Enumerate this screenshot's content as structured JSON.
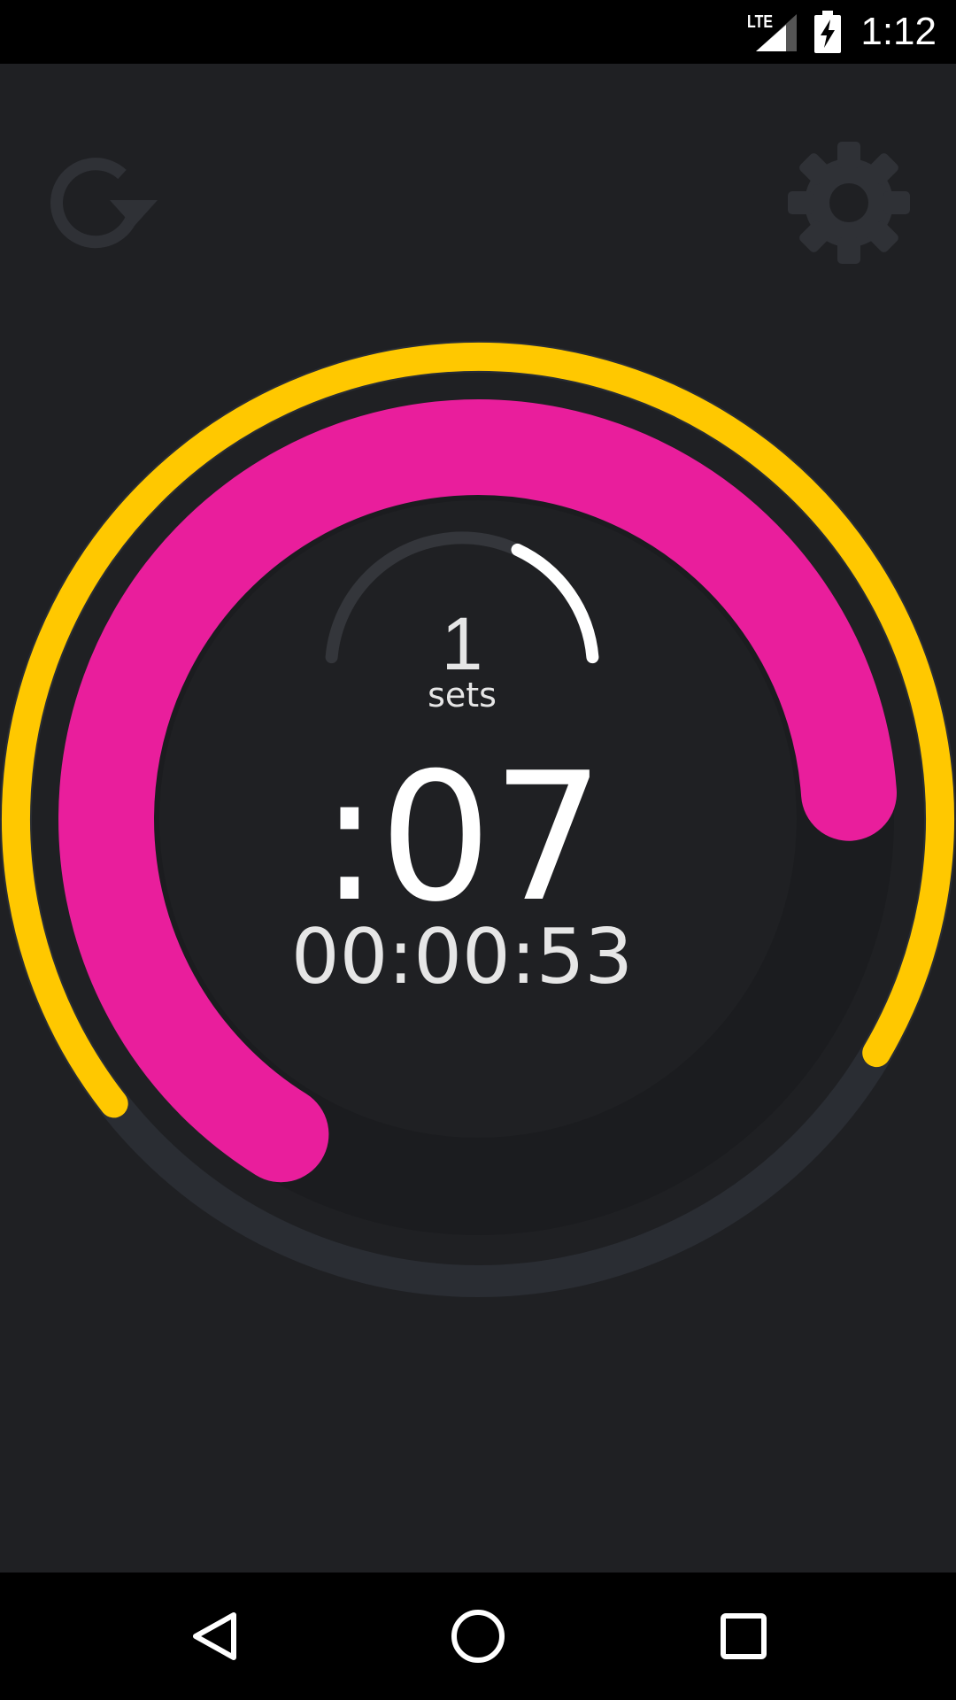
{
  "status_bar": {
    "time": "1:12",
    "network": "LTE",
    "icons": [
      "signal-icon",
      "battery-charging-icon"
    ]
  },
  "toolbar": {
    "reset_icon": "reset-icon",
    "settings_icon": "gear-icon"
  },
  "timer": {
    "sets_count": "1",
    "sets_label": "sets",
    "interval_remaining": ":07",
    "total_time": "00:00:53",
    "inner_arc_progress": 0.25,
    "pink_arc_progress": 0.65,
    "yellow_arc_progress": 0.69
  },
  "colors": {
    "background": "#1f2023",
    "pink": "#e91e9c",
    "yellow": "#ffc800",
    "track": "#2a2d33",
    "inner_face": "#1b1c1f"
  },
  "nav_bar": {
    "icons": [
      "back-icon",
      "home-icon",
      "recents-icon"
    ]
  }
}
